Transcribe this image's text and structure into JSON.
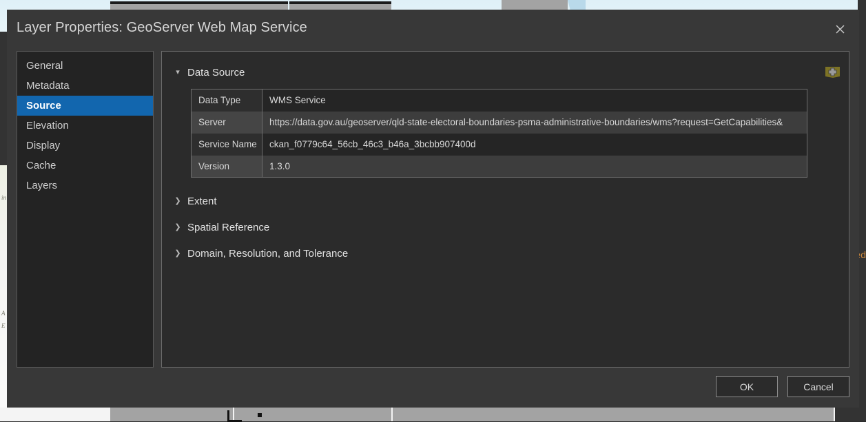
{
  "background": {
    "left_map_labels": [
      "in",
      "A",
      "E"
    ],
    "right_clipped_label": "fied"
  },
  "dialog": {
    "title": "Layer Properties: GeoServer Web Map Service",
    "close_icon": "close-icon",
    "sidebar": {
      "items": [
        {
          "label": "General",
          "selected": false
        },
        {
          "label": "Metadata",
          "selected": false
        },
        {
          "label": "Source",
          "selected": true
        },
        {
          "label": "Elevation",
          "selected": false
        },
        {
          "label": "Display",
          "selected": false
        },
        {
          "label": "Cache",
          "selected": false
        },
        {
          "label": "Layers",
          "selected": false
        }
      ]
    },
    "content": {
      "add_data_icon": "add-data-icon",
      "sections": [
        {
          "label": "Data Source",
          "expanded": true,
          "caret": "▾"
        },
        {
          "label": "Extent",
          "expanded": false,
          "caret": "❯"
        },
        {
          "label": "Spatial Reference",
          "expanded": false,
          "caret": "❯"
        },
        {
          "label": "Domain, Resolution, and Tolerance",
          "expanded": false,
          "caret": "❯"
        }
      ],
      "data_source_rows": [
        {
          "key": "Data Type",
          "value": "WMS Service"
        },
        {
          "key": "Server",
          "value": "https://data.gov.au/geoserver/qld-state-electoral-boundaries-psma-administrative-boundaries/wms?request=GetCapabilities&"
        },
        {
          "key": "Service Name",
          "value": "ckan_f0779c64_56cb_46c3_b46a_3bcbb907400d"
        },
        {
          "key": "Version",
          "value": "1.3.0"
        }
      ]
    },
    "footer": {
      "ok_label": "OK",
      "cancel_label": "Cancel"
    }
  },
  "colors": {
    "accent_selected": "#1266ae",
    "dialog_background": "#383838",
    "panel_background": "#2b2b2b",
    "sidebar_background": "#232323",
    "icon_olive": "#7d7325"
  }
}
